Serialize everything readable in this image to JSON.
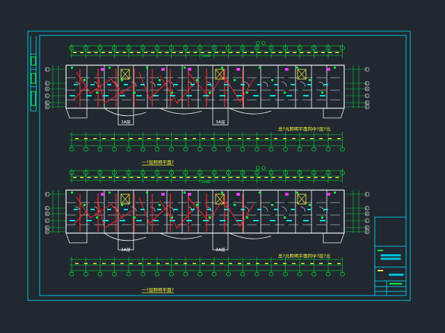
{
  "colors": {
    "background": "#212830",
    "frame": "#00c8e6",
    "wall": "#ffffff",
    "dim": "#00ff3c",
    "wire": "#ff2a2a",
    "room": "#00e6e6",
    "label_yellow": "#ffff3c",
    "magenta": "#ff3cff",
    "axis": "#e6e6e6"
  },
  "icons": [
    "stair-icon",
    "elevator-icon",
    "axis-bubble-icon"
  ],
  "drawing": {
    "plan_top_title": "一?层照明平面?",
    "plan_top_note": "总?元照明平面同中?层?元",
    "plan_bottom_title": "一?层照明平面?",
    "plan_bottom_note": "总?元照明平面同中?层?元",
    "stair_label": "3A层",
    "left_axes": [
      "F",
      "E",
      "D",
      "C",
      "B",
      "A"
    ],
    "right_axes": [
      "F",
      "E",
      "D",
      "C",
      "B",
      "A"
    ],
    "top_axis_numbers": [
      "1",
      "2",
      "3",
      "4",
      "5",
      "6",
      "7",
      "8",
      "9",
      "10",
      "11",
      "12",
      "13",
      "14",
      "15",
      "16",
      "17",
      "18",
      "19",
      "20"
    ],
    "dim_total": "52900"
  }
}
